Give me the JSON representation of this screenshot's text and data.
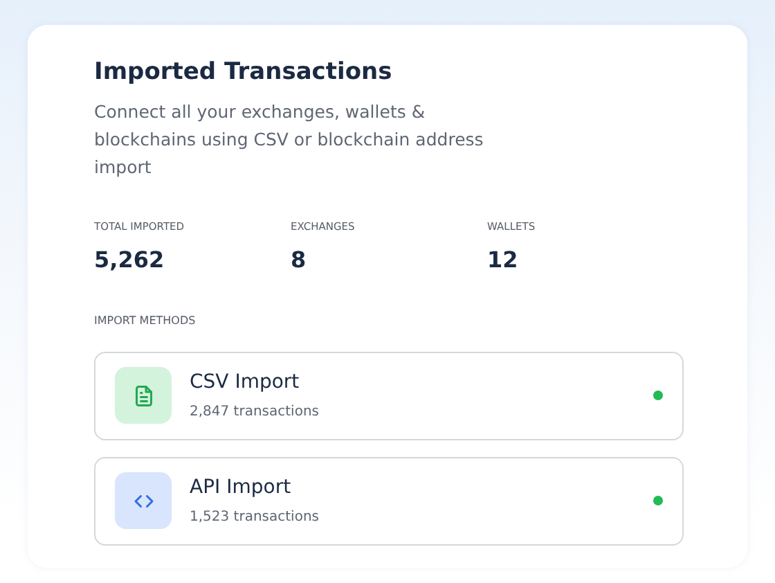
{
  "title": "Imported Transactions",
  "subtitle": "Connect all your exchanges, wallets & blockchains using CSV or blockchain address import",
  "stats": [
    {
      "label": "TOTAL IMPORTED",
      "value": "5,262"
    },
    {
      "label": "EXCHANGES",
      "value": "8"
    },
    {
      "label": "WALLETS",
      "value": "12"
    }
  ],
  "methods_label": "IMPORT METHODS",
  "methods": [
    {
      "kind": "csv",
      "name": "CSV Import",
      "count": "2,847 transactions",
      "active": true
    },
    {
      "kind": "api",
      "name": "API Import",
      "count": "1,523 transactions",
      "active": true
    }
  ]
}
